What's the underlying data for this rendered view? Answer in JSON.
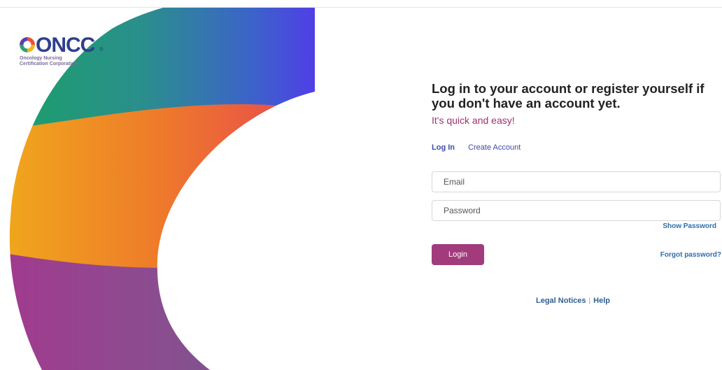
{
  "logo": {
    "wordmark": "ONCC",
    "tagline_line1": "Oncology Nursing",
    "tagline_line2": "Certification Corporation",
    "registered": "®"
  },
  "form": {
    "heading": "Log in to your account or register yourself if you don't have an account yet.",
    "subheading": "It's quick and easy!",
    "tabs": [
      {
        "label": "Log In",
        "active": true
      },
      {
        "label": "Create Account",
        "active": false
      }
    ],
    "email": {
      "placeholder": "Email",
      "value": ""
    },
    "password": {
      "placeholder": "Password",
      "value": ""
    },
    "show_password": "Show Password",
    "login_label": "Login",
    "forgot_password": "Forgot password?"
  },
  "footer": {
    "legal": "Legal Notices",
    "separator": "|",
    "help": "Help"
  },
  "colors": {
    "primary_button": "#a23b7c",
    "link": "#2f6da8",
    "tab_active": "#3f4aa6",
    "accent_text": "#a0306e"
  },
  "icons": {
    "art": "swirl-graphic"
  }
}
